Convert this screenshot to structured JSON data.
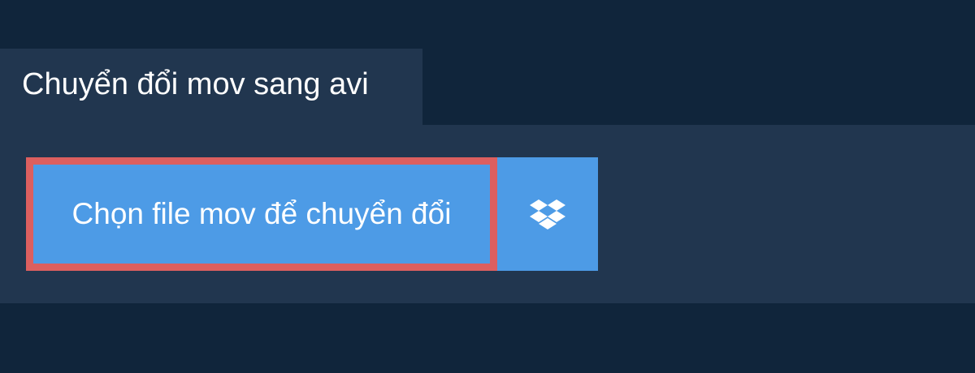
{
  "tab": {
    "title": "Chuyển đổi mov sang avi"
  },
  "upload": {
    "choose_file_label": "Chọn file mov để chuyển đổi",
    "dropbox_icon": "dropbox-icon"
  },
  "colors": {
    "background": "#10253b",
    "panel": "#21364f",
    "button": "#4d9be6",
    "highlight_border": "#dc5f5f",
    "text": "#ffffff"
  }
}
